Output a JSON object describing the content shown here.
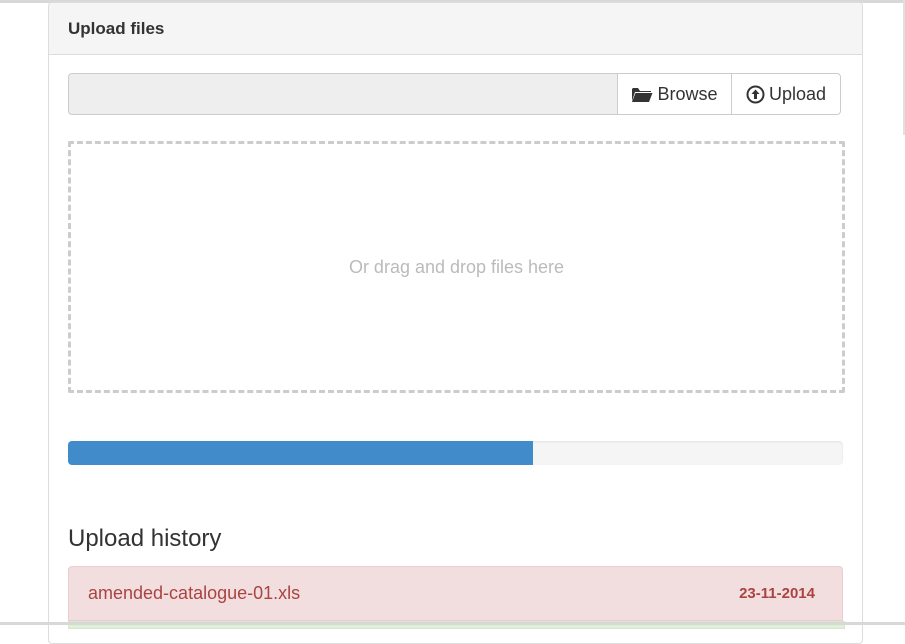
{
  "panel": {
    "title": "Upload files"
  },
  "file_input": {
    "value": ""
  },
  "buttons": {
    "browse_label": "Browse",
    "browse_icon": "folder-open-icon",
    "upload_label": "Upload",
    "upload_icon": "circle-arrow-up-icon"
  },
  "dropzone": {
    "text": "Or drag and drop files here"
  },
  "progress": {
    "fraction": 0.6,
    "color": "#428bca"
  },
  "history": {
    "title": "Upload history",
    "items": [
      {
        "filename": "amended-catalogue-01.xls",
        "date": "23-11-2014",
        "status_color": "#f2dede"
      }
    ]
  }
}
